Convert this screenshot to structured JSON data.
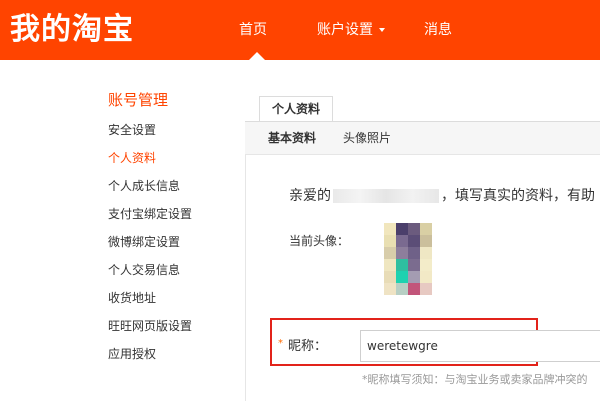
{
  "header": {
    "logo": "我的淘宝",
    "nav": {
      "home": "首页",
      "account_settings": "账户设置",
      "messages": "消息"
    }
  },
  "sidebar": {
    "title": "账号管理",
    "items": [
      {
        "label": "安全设置",
        "active": false
      },
      {
        "label": "个人资料",
        "active": true
      },
      {
        "label": "个人成长信息",
        "active": false
      },
      {
        "label": "支付宝绑定设置",
        "active": false
      },
      {
        "label": "微博绑定设置",
        "active": false
      },
      {
        "label": "个人交易信息",
        "active": false
      },
      {
        "label": "收货地址",
        "active": false
      },
      {
        "label": "旺旺网页版设置",
        "active": false
      },
      {
        "label": "应用授权",
        "active": false
      }
    ]
  },
  "main": {
    "tab": "个人资料",
    "subtabs": [
      "基本资料",
      "头像照片"
    ],
    "greeting_prefix": "亲爱的",
    "greeting_suffix": "，填写真实的资料，有助",
    "avatar_label": "当前头像：",
    "nickname": {
      "required_mark": "*",
      "label": "昵称：",
      "value": "weretewgre"
    },
    "hint": "*昵称填写须知：与淘宝业务或卖家品牌冲突的"
  },
  "colors": {
    "brand": "#ff4400",
    "highlight_box": "#e2231a"
  }
}
